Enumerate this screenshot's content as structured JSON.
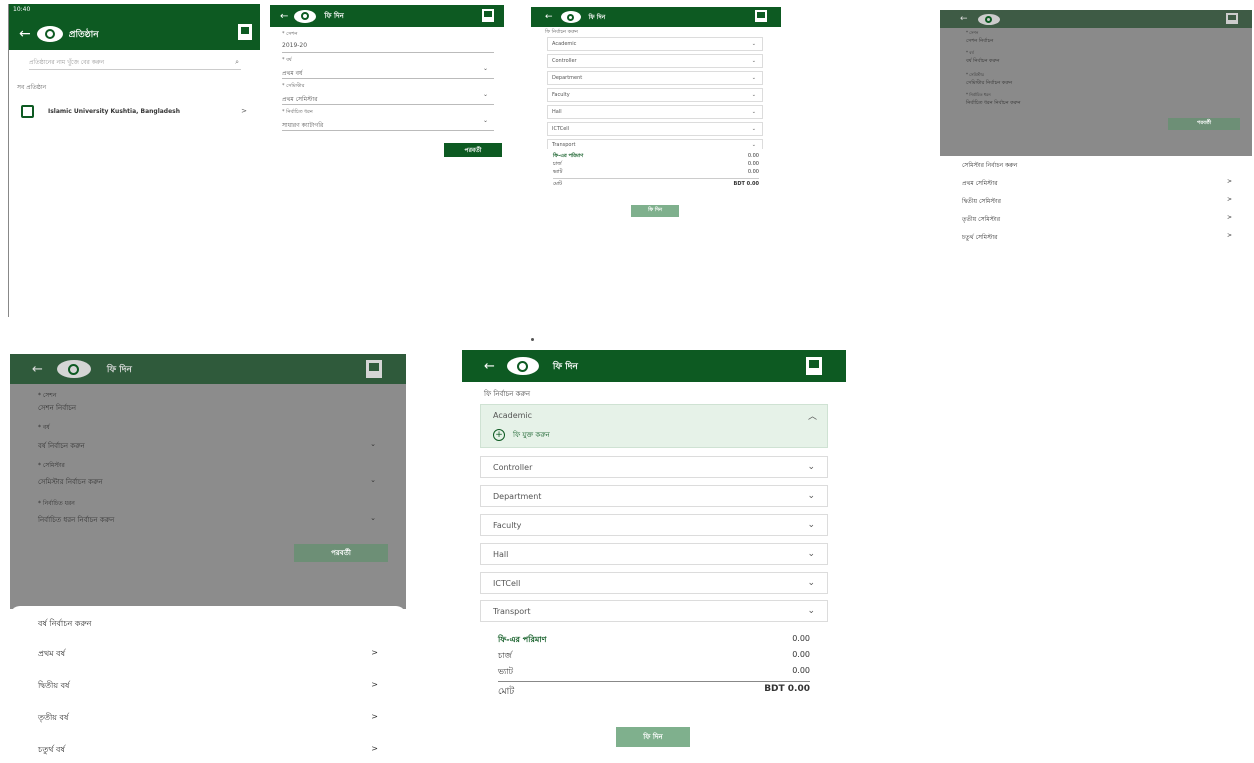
{
  "s1": {
    "status_time": "10:40",
    "title": "প্রতিষ্ঠান",
    "search_placeholder": "প্রতিষ্ঠানের নাম খুঁজে বের করুন",
    "section_label": "সব প্রতিষ্ঠান",
    "university": "Islamic University Kushtia, Bangladesh",
    "chevron": ">"
  },
  "s2": {
    "title": "ফি দিন",
    "fields": [
      {
        "label": "* সেশন",
        "value": "2019-20"
      },
      {
        "label": "* বর্ষ",
        "value": "প্রথম বর্ষ"
      },
      {
        "label": "* সেমিস্টার",
        "value": "প্রথম সেমিস্টার"
      },
      {
        "label": "* নির্বাচিত ধরন",
        "value": "সাধারণ ক্যাটাগরি"
      }
    ],
    "next": "পরবর্তী"
  },
  "s3": {
    "title": "ফি দিন",
    "subtitle": "ফি নির্বাচন করুন",
    "items": [
      "Academic",
      "Controller",
      "Department",
      "Faculty",
      "Hall",
      "ICTCell",
      "Transport"
    ],
    "summary": [
      {
        "label": "ফি-এর পরিমাণ",
        "value": "0.00"
      },
      {
        "label": "চার্জ",
        "value": "0.00"
      },
      {
        "label": "ভ্যাট",
        "value": "0.00"
      }
    ],
    "total_label": "মোট",
    "total": "BDT 0.00",
    "pay": "ফি দিন"
  },
  "s4": {
    "fields": [
      {
        "label": "* সেশন",
        "value": "সেশন নির্বাচন"
      },
      {
        "label": "* বর্ষ",
        "value": "বর্ষ নির্বাচন করুন"
      },
      {
        "label": "* সেমিস্টার",
        "value": "সেমিস্টার নির্বাচন করুন"
      },
      {
        "label": "* নির্বাচিত ধরন",
        "value": "নির্বাচিত ধরন নির্বাচন করুন"
      }
    ],
    "next": "পরবর্তী",
    "sheet_title": "সেমিস্টার নির্বাচন করুন",
    "options": [
      "প্রথম সেমিস্টার",
      "দ্বিতীয় সেমিস্টার",
      "তৃতীয় সেমিস্টার",
      "চতুর্থ সেমিস্টার"
    ],
    "chevron": ">"
  },
  "s5": {
    "title": "ফি দিন",
    "fields": [
      {
        "label": "* সেশন",
        "value": "সেশন নির্বাচন"
      },
      {
        "label": "* বর্ষ",
        "value": "বর্ষ নির্বাচন করুন"
      },
      {
        "label": "* সেমিস্টার",
        "value": "সেমিস্টার নির্বাচন করুন"
      },
      {
        "label": "* নির্বাচিত ধরন",
        "value": "নির্বাচিত ধরন নির্বাচন করুন"
      }
    ],
    "next": "পরবর্তী",
    "sheet_title": "বর্ষ নির্বাচন করুন",
    "options": [
      "প্রথম বর্ষ",
      "দ্বিতীয় বর্ষ",
      "তৃতীয় বর্ষ",
      "চতুর্থ বর্ষ"
    ],
    "chevron": ">"
  },
  "s6": {
    "title": "ফি দিন",
    "subtitle": "ফি নির্বাচন করুন",
    "expanded": "Academic",
    "add_fee": "ফি যুক্ত করুন",
    "items": [
      "Controller",
      "Department",
      "Faculty",
      "Hall",
      "ICTCell",
      "Transport"
    ],
    "summary": [
      {
        "label": "ফি-এর পরিমাণ",
        "value": "0.00"
      },
      {
        "label": "চার্জ",
        "value": "0.00"
      },
      {
        "label": "ভ্যাট",
        "value": "0.00"
      }
    ],
    "total_label": "মোট",
    "total": "BDT 0.00",
    "pay": "ফি দিন"
  },
  "colors": {
    "primary": "#0d5a22",
    "button_light": "#7fb08d",
    "expanded_bg": "#e6f2e8"
  }
}
